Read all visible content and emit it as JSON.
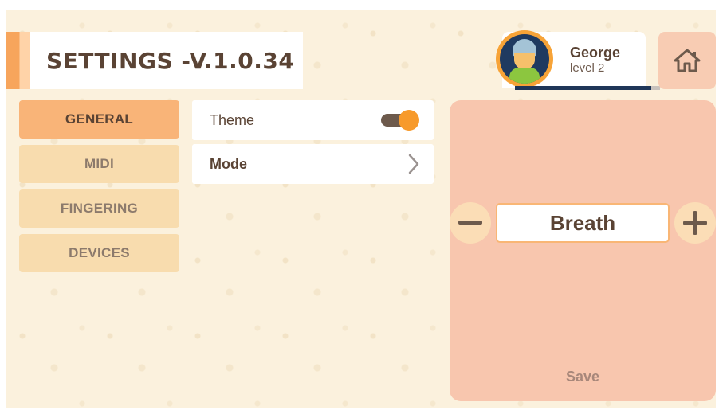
{
  "header": {
    "title": "SETTINGS -V.1.0.34"
  },
  "profile": {
    "name": "George",
    "level": "level 2",
    "progress": 0.94
  },
  "home_button": {
    "icon": "home-icon"
  },
  "menu": {
    "items": [
      {
        "label": "GENERAL",
        "active": true
      },
      {
        "label": "MIDI",
        "active": false
      },
      {
        "label": "FINGERING",
        "active": false
      },
      {
        "label": "DEVICES",
        "active": false
      }
    ]
  },
  "settings": {
    "theme": {
      "label": "Theme",
      "enabled": true
    },
    "mode": {
      "label": "Mode",
      "icon": "chevron-right-icon"
    }
  },
  "panel": {
    "mode_value": "Breath",
    "decrement_icon": "minus-icon",
    "increment_icon": "plus-icon",
    "save_label": "Save"
  },
  "colors": {
    "accent": "#f79a2b",
    "menu_active": "#f9b478",
    "menu_inactive": "#f8dcae",
    "panel": "#f8c6ae",
    "text": "#5a4334"
  }
}
